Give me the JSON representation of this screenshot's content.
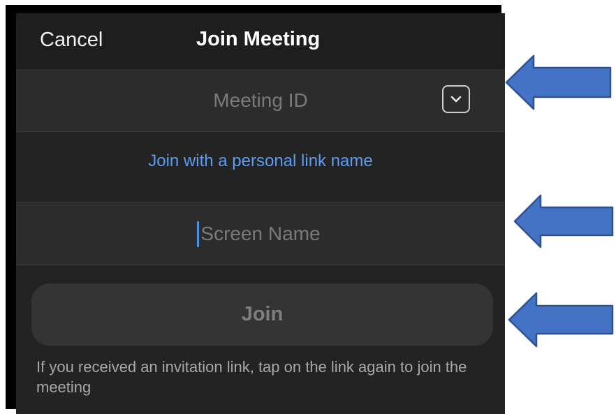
{
  "navbar": {
    "cancel_label": "Cancel",
    "title": "Join Meeting"
  },
  "meeting_id": {
    "placeholder": "Meeting ID",
    "dropdown_icon": "chevron-down-icon"
  },
  "personal_link_label": "Join with a personal link name",
  "screen_name": {
    "placeholder": "Screen Name"
  },
  "join_label": "Join",
  "hint_text": "If you received an invitation link, tap on the link again to join the meeting",
  "colors": {
    "background": "#232323",
    "field": "#2c2c2c",
    "link": "#5b9df2",
    "arrow": "#4472c4"
  },
  "annotations": {
    "arrow_icon": "left-arrow-icon",
    "count": 3
  }
}
